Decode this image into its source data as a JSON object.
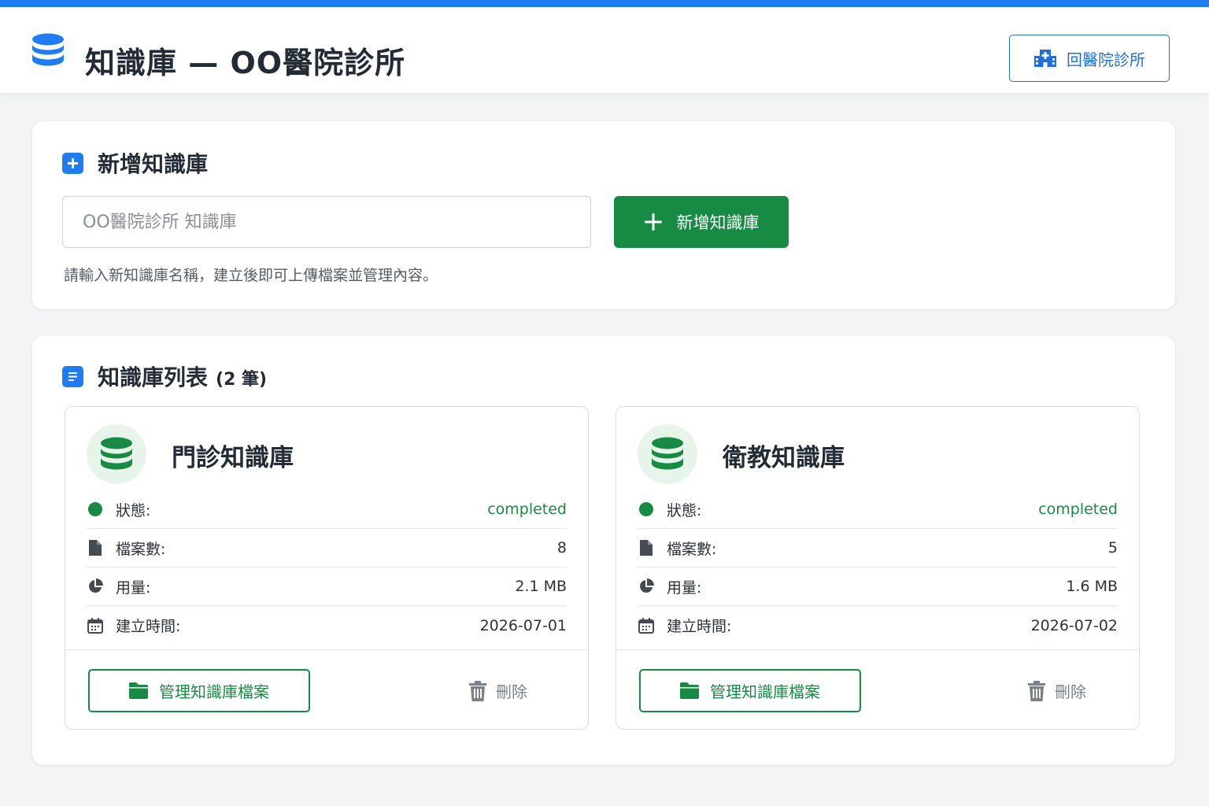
{
  "header": {
    "title": "知識庫 — OO醫院診所",
    "back_button_label": "回醫院診所",
    "logo_icon": "database-icon",
    "accent_color": "#1f7cf5"
  },
  "add_section": {
    "title": "新增知識庫",
    "input_placeholder": "OO醫院診所 知識庫",
    "input_value": "",
    "add_button_label": "新增知識庫",
    "helper_text": "請輸入新知識庫名稱，建立後即可上傳檔案並管理內容。",
    "button_color": "#178a43"
  },
  "list_section": {
    "title": "知識庫列表",
    "count_text": "(2 筆)",
    "items": [
      {
        "name": "門診知識庫",
        "status_label": "狀態:",
        "status_value": "completed",
        "files_label": "檔案數:",
        "files_value": "8",
        "usage_label": "用量:",
        "usage_value": "2.1 MB",
        "created_label": "建立時間:",
        "created_value": "2026-07-01",
        "manage_label": "管理知識庫檔案",
        "delete_label": "刪除"
      },
      {
        "name": "衛教知識庫",
        "status_label": "狀態:",
        "status_value": "completed",
        "files_label": "檔案數:",
        "files_value": "5",
        "usage_label": "用量:",
        "usage_value": "1.6 MB",
        "created_label": "建立時間:",
        "created_value": "2026-07-02",
        "manage_label": "管理知識庫檔案",
        "delete_label": "刪除"
      }
    ]
  }
}
